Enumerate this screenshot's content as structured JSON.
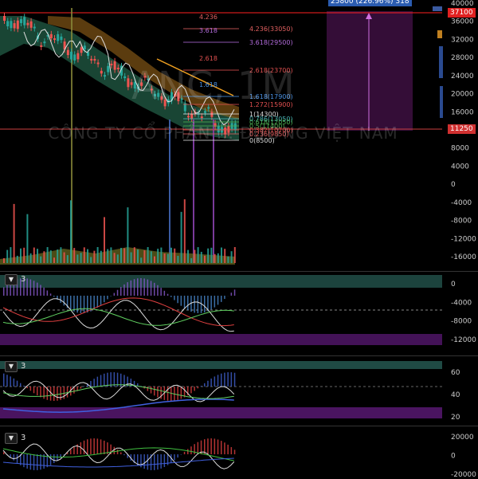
{
  "watermark": {
    "symbol": "ANC, 1M",
    "company": "CÔNG TY CỔ PHẦN ... ĐƯỜNG VIỆT NAM"
  },
  "measure_badge": "25800 (226.96%) 318",
  "price_badges": {
    "top": "37100",
    "current": "11250"
  },
  "fib_levels": [
    {
      "ratio_label": "4.236",
      "label": "4.236(33050)",
      "color": "#e06060"
    },
    {
      "ratio_label": "3.618",
      "label": "3.618(29500)",
      "color": "#b06ad9"
    },
    {
      "ratio_label": "2.618",
      "label": "2.618(23700)",
      "color": "#e05050"
    },
    {
      "ratio_label": "1.618",
      "label": "1.618(17900)",
      "color": "#4a90e2"
    },
    {
      "ratio_label": "",
      "label": "1.272(15900)",
      "color": "#e05050"
    },
    {
      "ratio_label": "",
      "label": "1(14300)",
      "color": "#dddddd"
    },
    {
      "ratio_label": "",
      "label": "0.786(13050)",
      "color": "#49b6b6"
    },
    {
      "ratio_label": "",
      "label": "0.618(12050)",
      "color": "#4caf50"
    },
    {
      "ratio_label": "",
      "label": "0.5(11400)",
      "color": "#4caf50"
    },
    {
      "ratio_label": "",
      "label": "0.382(10700)",
      "color": "#e05050"
    },
    {
      "ratio_label": "",
      "label": "0.236(9850)",
      "color": "#e06060"
    },
    {
      "ratio_label": "",
      "label": "0(8500)",
      "color": "#dddddd"
    }
  ],
  "main_axis_labels": [
    "40000",
    "36000",
    "32000",
    "28000",
    "24000",
    "20000",
    "16000",
    "12000",
    "8000",
    "4000",
    "0",
    "-4000",
    "-8000",
    "-12000",
    "-16000"
  ],
  "panels": [
    {
      "toggle": "3",
      "axis_labels": [
        "0",
        "-4000",
        "-8000",
        "-12000"
      ]
    },
    {
      "toggle": "3",
      "axis_labels": [
        "60",
        "40",
        "20"
      ]
    },
    {
      "toggle": "3",
      "axis_labels": [
        "20000",
        "0",
        "-20000"
      ]
    }
  ],
  "colors": {
    "background": "#000000",
    "up": "#26a69a",
    "down": "#ef5350",
    "highlight": "#ff2020",
    "purple_zone": "#5a1a6a"
  }
}
